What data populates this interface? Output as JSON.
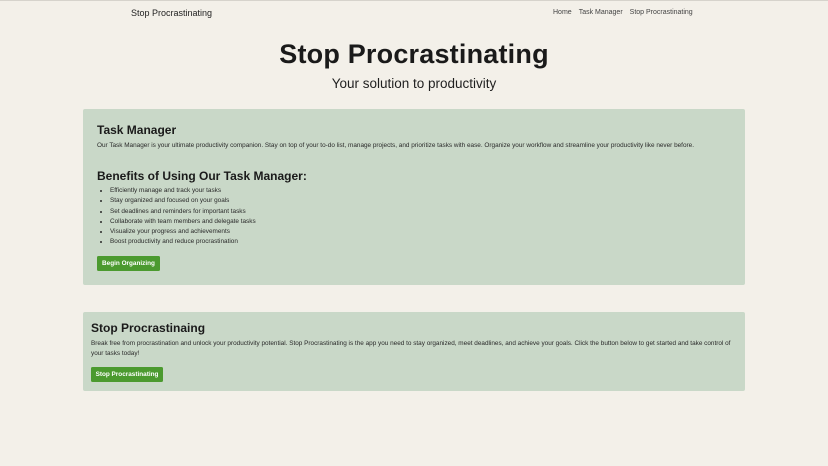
{
  "nav": {
    "brand": "Stop Procrastinating",
    "links": [
      "Home",
      "Task Manager",
      "Stop Procrastinating"
    ]
  },
  "hero": {
    "title": "Stop Procrastinating",
    "subtitle": "Your solution to productivity"
  },
  "task_card": {
    "title": "Task Manager",
    "description": "Our Task Manager is your ultimate productivity companion. Stay on top of your to-do list, manage projects, and prioritize tasks with ease. Organize your workflow and streamline your productivity like never before.",
    "benefits_title": "Benefits of Using Our Task Manager:",
    "benefits": [
      "Efficiently manage and track your tasks",
      "Stay organized and focused on your goals",
      "Set deadlines and reminders for important tasks",
      "Collaborate with team members and delegate tasks",
      "Visualize your progress and achievements",
      "Boost productivity and reduce procrastination"
    ],
    "button": "Begin Organizing"
  },
  "stop_card": {
    "title": "Stop Procrastinaing",
    "description": "Break free from procrastination and unlock your productivity potential. Stop Procrastinating is the app you need to stay organized, meet deadlines, and achieve your goals. Click the button below to get started and take control of your tasks today!",
    "button": "Stop Procrastinating"
  },
  "colors": {
    "background": "#f3f0e9",
    "card": "#c9d8c8",
    "button": "#4b9a2f"
  }
}
